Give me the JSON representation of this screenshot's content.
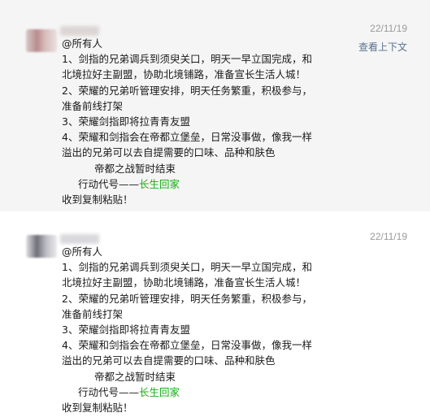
{
  "messages": [
    {
      "timestamp": "22/11/19",
      "context_link": "查看上下文",
      "lines": [
        "@所有人",
        "1、剑指的兄弟调兵到须臾关口，明天一早立国完成，和",
        "北境拉好主副盟，协助北境铺路，准备宣长生活人城！",
        "2、荣耀的兄弟听管理安排，明天任务繁重，积极参与，",
        "准备前线打架",
        "3、荣耀剑指即将拉青青友盟",
        "4、荣耀和剑指会在帝都立堡垒，日常没事做，像我一样",
        "溢出的兄弟可以去自提需要的口味、品种和肤色",
        "帝都之战暂时结束",
        "行动代号——",
        "长生回家",
        "收到复制粘贴！"
      ]
    },
    {
      "timestamp": "22/11/19",
      "lines": [
        "@所有人",
        "1、剑指的兄弟调兵到须臾关口，明天一早立国完成，和",
        "北境拉好主副盟，协助北境铺路，准备宣长生活人城！",
        "2、荣耀的兄弟听管理安排，明天任务繁重，积极参与，",
        "准备前线打架",
        "3、荣耀剑指即将拉青青友盟",
        "4、荣耀和剑指会在帝都立堡垒，日常没事做，像我一样",
        "溢出的兄弟可以去自提需要的口味、品种和肤色",
        "帝都之战暂时结束",
        "行动代号——",
        "长生回家",
        "收到复制粘贴！"
      ]
    }
  ],
  "colors": {
    "highlight_bg": "#f5f5f5",
    "link": "#56728f",
    "green_text": "#1aad19",
    "time": "#9a9a9a"
  }
}
